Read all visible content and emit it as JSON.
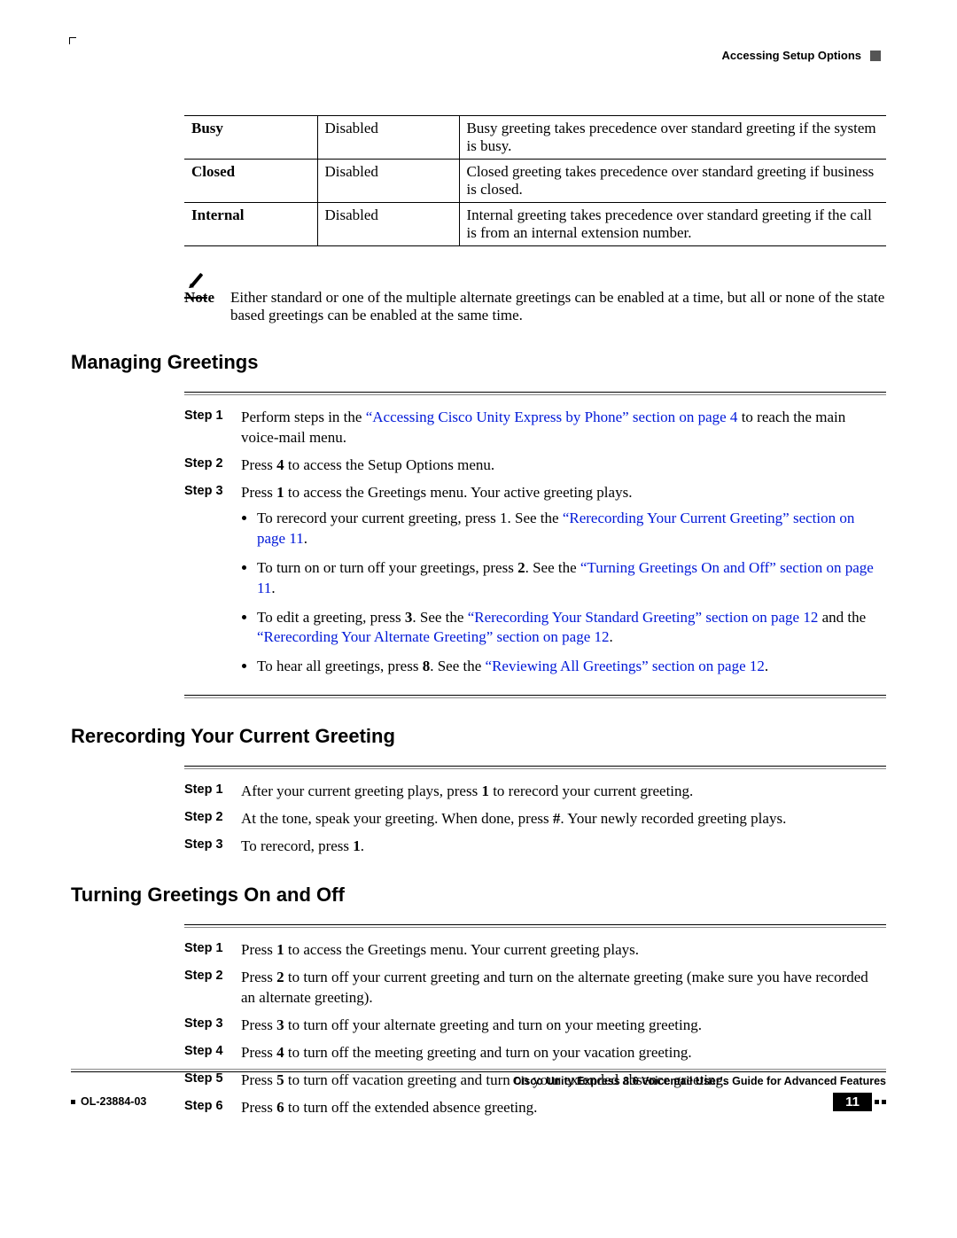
{
  "header": {
    "right_label": "Accessing Setup Options"
  },
  "table_rows": [
    {
      "name": "Busy",
      "status": "Disabled",
      "desc": "Busy greeting takes precedence over standard greeting if the system is busy."
    },
    {
      "name": "Closed",
      "status": "Disabled",
      "desc": "Closed greeting takes precedence over standard greeting if business is closed."
    },
    {
      "name": "Internal",
      "status": "Disabled",
      "desc": "Internal greeting takes precedence over standard greeting if the call is from an internal extension number."
    }
  ],
  "note": {
    "label": "Note",
    "text": "Either standard or one of the multiple alternate greetings can be enabled at a time, but all or none of the state based greetings can be enabled at the same time."
  },
  "sections": {
    "managing": {
      "title": "Managing Greetings",
      "step1": {
        "label": "Step 1",
        "pre": "Perform steps in the ",
        "link": "“Accessing Cisco Unity Express by Phone” section on page 4",
        "post": " to reach the main voice-mail menu."
      },
      "step2": {
        "label": "Step 2",
        "a": "Press ",
        "key": "4",
        "b": " to access the Setup Options menu."
      },
      "step3": {
        "label": "Step 3",
        "a": "Press ",
        "key": "1",
        "b": " to access the Greetings menu. Your active greeting plays.",
        "bul1": {
          "text": "To rerecord your current greeting, press 1. See the ",
          "link": "“Rerecording Your Current Greeting” section on page 11",
          "post": "."
        },
        "bul2": {
          "a": "To turn on or turn off your greetings, press ",
          "key": "2",
          "b": ". See the ",
          "link": "“Turning Greetings On and Off” section on page 11",
          "post": "."
        },
        "bul3": {
          "a": "To edit a greeting, press ",
          "key": "3",
          "b": ". See the ",
          "link1": "“Rerecording Your Standard Greeting” section on page 12",
          "mid": " and the ",
          "link2": "“Rerecording Your Alternate Greeting” section on page 12",
          "post": "."
        },
        "bul4": {
          "a": "To hear all greetings, press ",
          "key": "8",
          "b": ". See the ",
          "link": "“Reviewing All Greetings” section on page 12",
          "post": "."
        }
      }
    },
    "rerecord": {
      "title": "Rerecording Your Current Greeting",
      "step1": {
        "label": "Step 1",
        "a": "After your current greeting plays, press ",
        "key": "1",
        "b": " to rerecord your current greeting."
      },
      "step2": {
        "label": "Step 2",
        "a": "At the tone, speak your greeting. When done, press ",
        "key": "#",
        "b": ". Your newly recorded greeting plays."
      },
      "step3": {
        "label": "Step 3",
        "a": "To rerecord, press ",
        "key": "1",
        "b": "."
      }
    },
    "turning": {
      "title": "Turning Greetings On and Off",
      "step1": {
        "label": "Step 1",
        "a": "Press ",
        "key": "1",
        "b": " to access the Greetings menu. Your current greeting plays."
      },
      "step2": {
        "label": "Step 2",
        "a": "Press ",
        "key": "2",
        "b": " to turn off your current greeting and turn on the alternate greeting (make sure you have recorded an alternate greeting)."
      },
      "step3": {
        "label": "Step 3",
        "a": "Press ",
        "key": "3",
        "b": " to turn off your alternate greeting and turn on your meeting greeting."
      },
      "step4": {
        "label": "Step 4",
        "a": "Press ",
        "key": "4",
        "b": " to turn off the meeting greeting and turn on your vacation greeting."
      },
      "step5": {
        "label": "Step 5",
        "a": "Press ",
        "key": "5",
        "b": " to turn off vacation greeting and turn on your extended absence greeting."
      },
      "step6": {
        "label": "Step 6",
        "a": "Press ",
        "key": "6",
        "b": " to turn off the extended absence greeting."
      }
    }
  },
  "footer": {
    "guide": "Cisco Unity Express 8.6 Voicemail User's Guide for Advanced Features",
    "docnum": "OL-23884-03",
    "page": "11"
  }
}
